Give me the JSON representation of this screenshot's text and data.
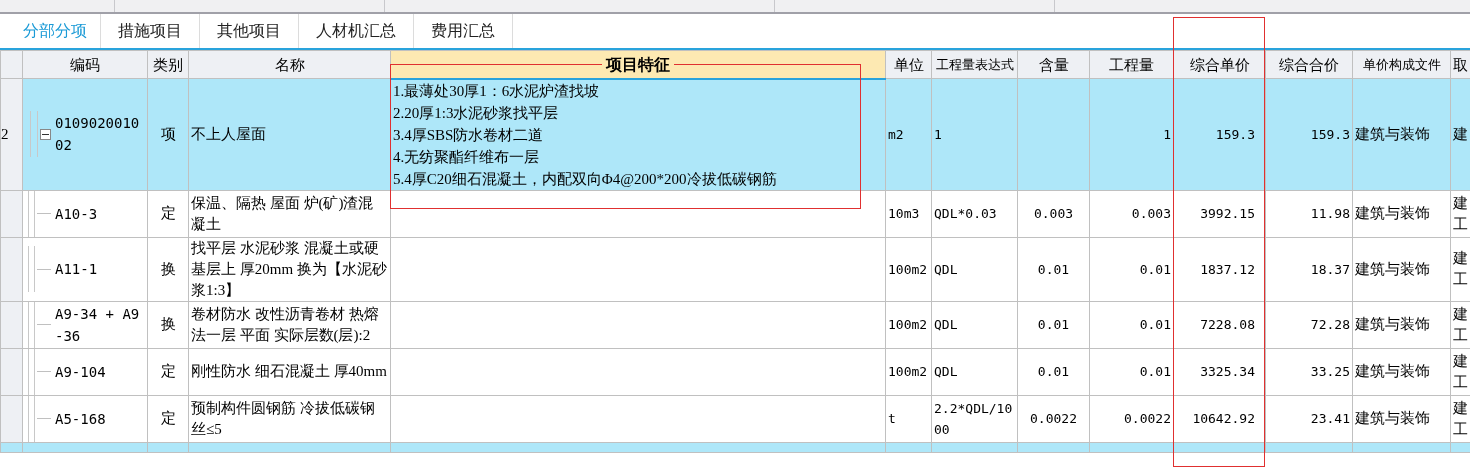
{
  "tabs": [
    {
      "label": "分部分项",
      "selected": true
    },
    {
      "label": "措施项目",
      "selected": false
    },
    {
      "label": "其他项目",
      "selected": false
    },
    {
      "label": "人材机汇总",
      "selected": false
    },
    {
      "label": "费用汇总",
      "selected": false
    }
  ],
  "columns": [
    "编码",
    "类别",
    "名称",
    "项目特征",
    "单位",
    "工程量表达式",
    "含量",
    "工程量",
    "综合单价",
    "综合合价",
    "单价构成文件",
    "取"
  ],
  "rows": [
    {
      "row_number": "2",
      "code": "010902001002",
      "expanded": true,
      "selected": true,
      "category": "项",
      "name": "不上人屋面",
      "features": [
        "1.最薄处30厚1：6水泥炉渣找坡",
        "2.20厚1:3水泥砂浆找平层",
        "3.4厚SBS防水卷材二道",
        "4.无纺聚酯纤维布一层",
        "5.4厚C20细石混凝土，内配双向Φ4@200*200冷拔低碳钢筋"
      ],
      "unit": "m2",
      "expression": "1",
      "content": "",
      "quantity": "1",
      "unit_price": "159.3",
      "total_price": "159.3",
      "price_file": "建筑与装饰",
      "column_12": "建",
      "children": [
        {
          "code": "A10-3",
          "selected": false,
          "category": "定",
          "name": "保温、隔热 屋面 炉(矿)渣混凝土",
          "unit": "10m3",
          "expression": "QDL*0.03",
          "content": "0.003",
          "quantity": "0.003",
          "unit_price": "3992.15",
          "total_price": "11.98",
          "price_file": "建筑与装饰",
          "column_12": "建工"
        },
        {
          "code": "A11-1",
          "selected": false,
          "category": "换",
          "name": "找平层 水泥砂浆 混凝土或硬基层上 厚20mm  换为【水泥砂浆1:3】",
          "unit": "100m2",
          "expression": "QDL",
          "content": "0.01",
          "quantity": "0.01",
          "unit_price": "1837.12",
          "total_price": "18.37",
          "price_file": "建筑与装饰",
          "column_12": "建工"
        },
        {
          "code": "A9-34 + A9-36",
          "selected": false,
          "category": "换",
          "name": "卷材防水 改性沥青卷材 热熔法一层 平面  实际层数(层):2",
          "unit": "100m2",
          "expression": "QDL",
          "content": "0.01",
          "quantity": "0.01",
          "unit_price": "7228.08",
          "total_price": "72.28",
          "price_file": "建筑与装饰",
          "column_12": "建工"
        },
        {
          "code": "A9-104",
          "selected": false,
          "category": "定",
          "name": "刚性防水 细石混凝土 厚40mm",
          "unit": "100m2",
          "expression": "QDL",
          "content": "0.01",
          "quantity": "0.01",
          "unit_price": "3325.34",
          "total_price": "33.25",
          "price_file": "建筑与装饰",
          "column_12": "建工"
        },
        {
          "code": "A5-168",
          "selected": false,
          "category": "定",
          "name": "预制构件圆钢筋 冷拔低碳钢丝≤5",
          "unit": "t",
          "expression": "2.2*QDL/1000",
          "content": "0.0022",
          "quantity": "0.0022",
          "unit_price": "10642.92",
          "total_price": "23.41",
          "price_file": "建筑与装饰",
          "column_12": "建工"
        }
      ]
    }
  ]
}
